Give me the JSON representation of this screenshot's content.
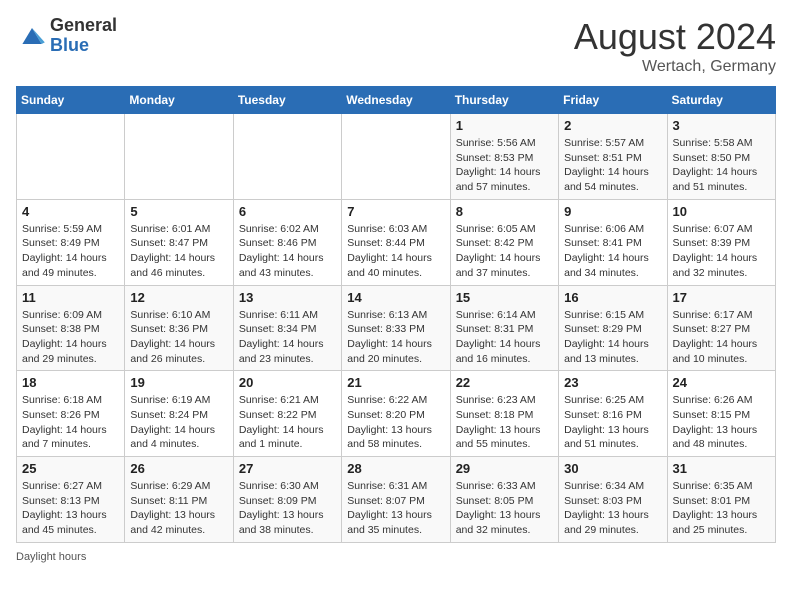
{
  "header": {
    "logo_line1": "General",
    "logo_line2": "Blue",
    "month": "August 2024",
    "location": "Wertach, Germany"
  },
  "footer": {
    "label": "Daylight hours"
  },
  "days_of_week": [
    "Sunday",
    "Monday",
    "Tuesday",
    "Wednesday",
    "Thursday",
    "Friday",
    "Saturday"
  ],
  "weeks": [
    [
      {
        "day": "",
        "info": ""
      },
      {
        "day": "",
        "info": ""
      },
      {
        "day": "",
        "info": ""
      },
      {
        "day": "",
        "info": ""
      },
      {
        "day": "1",
        "info": "Sunrise: 5:56 AM\nSunset: 8:53 PM\nDaylight: 14 hours and 57 minutes."
      },
      {
        "day": "2",
        "info": "Sunrise: 5:57 AM\nSunset: 8:51 PM\nDaylight: 14 hours and 54 minutes."
      },
      {
        "day": "3",
        "info": "Sunrise: 5:58 AM\nSunset: 8:50 PM\nDaylight: 14 hours and 51 minutes."
      }
    ],
    [
      {
        "day": "4",
        "info": "Sunrise: 5:59 AM\nSunset: 8:49 PM\nDaylight: 14 hours and 49 minutes."
      },
      {
        "day": "5",
        "info": "Sunrise: 6:01 AM\nSunset: 8:47 PM\nDaylight: 14 hours and 46 minutes."
      },
      {
        "day": "6",
        "info": "Sunrise: 6:02 AM\nSunset: 8:46 PM\nDaylight: 14 hours and 43 minutes."
      },
      {
        "day": "7",
        "info": "Sunrise: 6:03 AM\nSunset: 8:44 PM\nDaylight: 14 hours and 40 minutes."
      },
      {
        "day": "8",
        "info": "Sunrise: 6:05 AM\nSunset: 8:42 PM\nDaylight: 14 hours and 37 minutes."
      },
      {
        "day": "9",
        "info": "Sunrise: 6:06 AM\nSunset: 8:41 PM\nDaylight: 14 hours and 34 minutes."
      },
      {
        "day": "10",
        "info": "Sunrise: 6:07 AM\nSunset: 8:39 PM\nDaylight: 14 hours and 32 minutes."
      }
    ],
    [
      {
        "day": "11",
        "info": "Sunrise: 6:09 AM\nSunset: 8:38 PM\nDaylight: 14 hours and 29 minutes."
      },
      {
        "day": "12",
        "info": "Sunrise: 6:10 AM\nSunset: 8:36 PM\nDaylight: 14 hours and 26 minutes."
      },
      {
        "day": "13",
        "info": "Sunrise: 6:11 AM\nSunset: 8:34 PM\nDaylight: 14 hours and 23 minutes."
      },
      {
        "day": "14",
        "info": "Sunrise: 6:13 AM\nSunset: 8:33 PM\nDaylight: 14 hours and 20 minutes."
      },
      {
        "day": "15",
        "info": "Sunrise: 6:14 AM\nSunset: 8:31 PM\nDaylight: 14 hours and 16 minutes."
      },
      {
        "day": "16",
        "info": "Sunrise: 6:15 AM\nSunset: 8:29 PM\nDaylight: 14 hours and 13 minutes."
      },
      {
        "day": "17",
        "info": "Sunrise: 6:17 AM\nSunset: 8:27 PM\nDaylight: 14 hours and 10 minutes."
      }
    ],
    [
      {
        "day": "18",
        "info": "Sunrise: 6:18 AM\nSunset: 8:26 PM\nDaylight: 14 hours and 7 minutes."
      },
      {
        "day": "19",
        "info": "Sunrise: 6:19 AM\nSunset: 8:24 PM\nDaylight: 14 hours and 4 minutes."
      },
      {
        "day": "20",
        "info": "Sunrise: 6:21 AM\nSunset: 8:22 PM\nDaylight: 14 hours and 1 minute."
      },
      {
        "day": "21",
        "info": "Sunrise: 6:22 AM\nSunset: 8:20 PM\nDaylight: 13 hours and 58 minutes."
      },
      {
        "day": "22",
        "info": "Sunrise: 6:23 AM\nSunset: 8:18 PM\nDaylight: 13 hours and 55 minutes."
      },
      {
        "day": "23",
        "info": "Sunrise: 6:25 AM\nSunset: 8:16 PM\nDaylight: 13 hours and 51 minutes."
      },
      {
        "day": "24",
        "info": "Sunrise: 6:26 AM\nSunset: 8:15 PM\nDaylight: 13 hours and 48 minutes."
      }
    ],
    [
      {
        "day": "25",
        "info": "Sunrise: 6:27 AM\nSunset: 8:13 PM\nDaylight: 13 hours and 45 minutes."
      },
      {
        "day": "26",
        "info": "Sunrise: 6:29 AM\nSunset: 8:11 PM\nDaylight: 13 hours and 42 minutes."
      },
      {
        "day": "27",
        "info": "Sunrise: 6:30 AM\nSunset: 8:09 PM\nDaylight: 13 hours and 38 minutes."
      },
      {
        "day": "28",
        "info": "Sunrise: 6:31 AM\nSunset: 8:07 PM\nDaylight: 13 hours and 35 minutes."
      },
      {
        "day": "29",
        "info": "Sunrise: 6:33 AM\nSunset: 8:05 PM\nDaylight: 13 hours and 32 minutes."
      },
      {
        "day": "30",
        "info": "Sunrise: 6:34 AM\nSunset: 8:03 PM\nDaylight: 13 hours and 29 minutes."
      },
      {
        "day": "31",
        "info": "Sunrise: 6:35 AM\nSunset: 8:01 PM\nDaylight: 13 hours and 25 minutes."
      }
    ]
  ]
}
